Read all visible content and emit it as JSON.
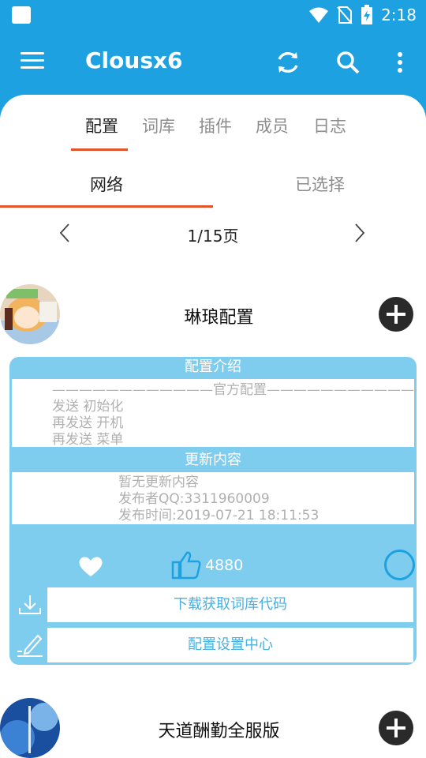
{
  "status": {
    "time": "2:18"
  },
  "toolbar": {
    "title": "Clousx6"
  },
  "main_tabs": [
    "配置",
    "词库",
    "插件",
    "成员",
    "日志"
  ],
  "sub_tabs": [
    "网络",
    "已选择"
  ],
  "pager": {
    "text": "1/15页"
  },
  "items": [
    {
      "title": "琳琅配置",
      "intro_label": "配置介绍",
      "intro_lines": [
        "————————————官方配置————————————",
        "发送 初始化",
        "再发送 开机",
        "再发送 菜单"
      ],
      "update_label": "更新内容",
      "update_lines": [
        "暂无更新内容",
        "发布者QQ:3311960009",
        "发布时间:2019-07-21 18:11:53"
      ],
      "likes": "4880",
      "download_label": "下载获取词库代码",
      "settings_label": "配置设置中心"
    },
    {
      "title": "天道酬勤全服版"
    }
  ],
  "colors": {
    "primary": "#1ea1e0",
    "card": "#7fcdee",
    "accent": "#e0552b"
  }
}
